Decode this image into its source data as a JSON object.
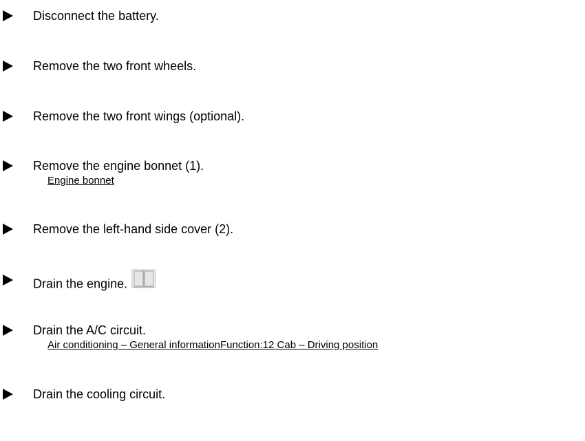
{
  "steps": [
    {
      "text": "Disconnect the battery."
    },
    {
      "text": "Remove the two front wheels."
    },
    {
      "text": "Remove the two front wings (optional)."
    },
    {
      "text": "Remove the engine bonnet (1).",
      "link": "Engine bonnet"
    },
    {
      "text": "Remove the left-hand side cover (2)."
    },
    {
      "text": "Drain the engine.",
      "icon": "manual-book-icon"
    },
    {
      "text": "Drain the A/C circuit.",
      "link": "Air conditioning – General informationFunction:12 Cab – Driving position"
    },
    {
      "text": "Drain the cooling circuit."
    }
  ],
  "colors": {
    "text": "#000000",
    "icon_fill": "#e6e6e6",
    "icon_stroke": "#b8b8b8"
  }
}
